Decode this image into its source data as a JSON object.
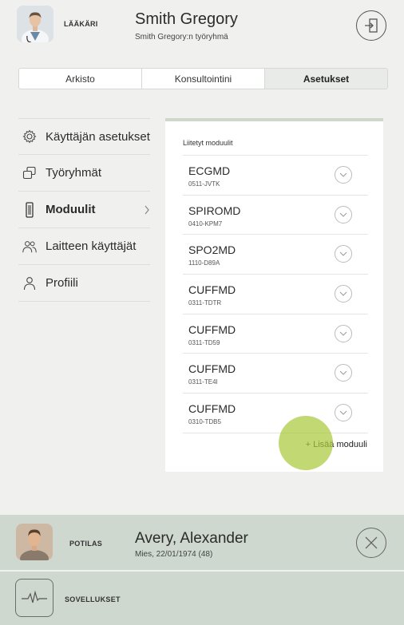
{
  "header": {
    "role": "LÄÄKÄRI",
    "name": "Smith Gregory",
    "subtitle": "Smith Gregory:n työryhmä",
    "logout_icon": "logout-icon"
  },
  "tabs": [
    {
      "label": "Arkisto",
      "active": false
    },
    {
      "label": "Konsultointini",
      "active": false
    },
    {
      "label": "Asetukset",
      "active": true
    }
  ],
  "side_menu": [
    {
      "label": "Käyttäjän asetukset",
      "icon": "gear-icon"
    },
    {
      "label": "Työryhmät",
      "icon": "groups-icon"
    },
    {
      "label": "Moduulit",
      "icon": "device-icon",
      "active": true
    },
    {
      "label": "Laitteen käyttäjät",
      "icon": "users-icon"
    },
    {
      "label": "Profiili",
      "icon": "person-icon"
    }
  ],
  "modules_panel": {
    "title": "Liitetyt moduulit",
    "add_label": "+ Lisää moduuli",
    "modules": [
      {
        "name": "ECGMD",
        "code": "0511-JVTK"
      },
      {
        "name": "SPIROMD",
        "code": "0410-KPM7"
      },
      {
        "name": "SPO2MD",
        "code": "1110-D89A"
      },
      {
        "name": "CUFFMD",
        "code": "0311-TDTR"
      },
      {
        "name": "CUFFMD",
        "code": "0311-TD59"
      },
      {
        "name": "CUFFMD",
        "code": "0311-TE4I"
      },
      {
        "name": "CUFFMD",
        "code": "0310-TDB5"
      }
    ]
  },
  "patient": {
    "role": "POTILAS",
    "name": "Avery, Alexander",
    "details": "Mies, 22/01/1974 (48)"
  },
  "apps": {
    "label": "SOVELLUKSET",
    "icon": "ecg-wave-icon"
  },
  "colors": {
    "accent_green": "#aac93c",
    "bar_bg": "#cfd8cf",
    "page_bg": "#f0f1ef"
  }
}
